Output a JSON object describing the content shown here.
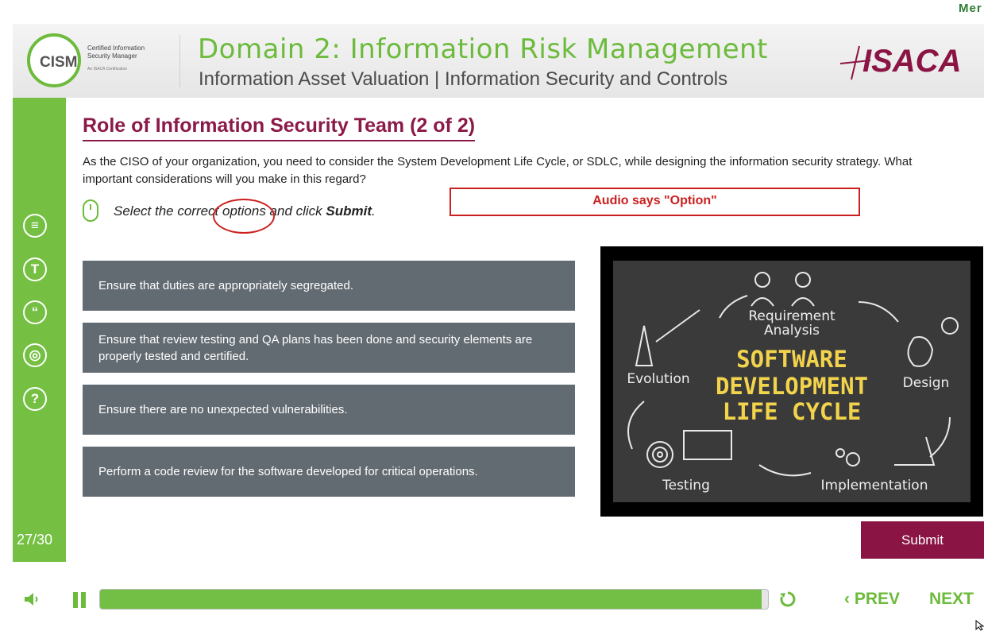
{
  "corner_text": "Mer",
  "header": {
    "logo_text": "CISM",
    "logo_sub_line1": "Certified Information",
    "logo_sub_line2": "Security Manager",
    "logo_sub_small": "An ISACA Certification",
    "domain_title": "Domain 2: Information Risk Management",
    "domain_subtitle": "Information Asset Valuation | Information Security and Controls",
    "brand": "ISACA"
  },
  "sidebar": {
    "icons": [
      "menu-icon",
      "transcript-icon",
      "quote-icon",
      "resources-icon",
      "help-icon"
    ],
    "icon_glyphs": [
      "≡",
      "T",
      "“",
      "◎",
      "?"
    ],
    "slide_counter": "27/30"
  },
  "slide": {
    "title": "Role of Information Security Team (2 of 2)",
    "question": "As the CISO of your organization, you need to consider the System Development Life Cycle, or SDLC, while designing the information security strategy. What important considerations will you make in this regard?",
    "instruction_prefix": "Select the correct options and click ",
    "instruction_bold": "Submit",
    "instruction_suffix": ".",
    "annotation": "Audio says \"Option\"",
    "options": [
      "Ensure that duties are appropriately segregated.",
      "Ensure that review testing and QA plans has been done and security elements are properly tested and certified.",
      "Ensure there are no unexpected vulnerabilities.",
      "Perform a code review for the software developed for critical operations."
    ],
    "submit_label": "Submit"
  },
  "sdlc_image": {
    "line1": "SOFTWARE",
    "line2": "DEVELOPMENT",
    "line3": "LIFE CYCLE",
    "stage_requirement_1": "Requirement",
    "stage_requirement_2": "Analysis",
    "stage_design": "Design",
    "stage_implementation": "Implementation",
    "stage_testing": "Testing",
    "stage_evolution": "Evolution"
  },
  "player": {
    "progress_fraction": 0.99,
    "prev_label": "PREV",
    "next_label": "NEXT"
  },
  "colors": {
    "accent_green": "#6cbb3c",
    "title_maroon": "#8a1a48",
    "option_gray": "#636b72",
    "annotation_red": "#cc1f1f"
  }
}
